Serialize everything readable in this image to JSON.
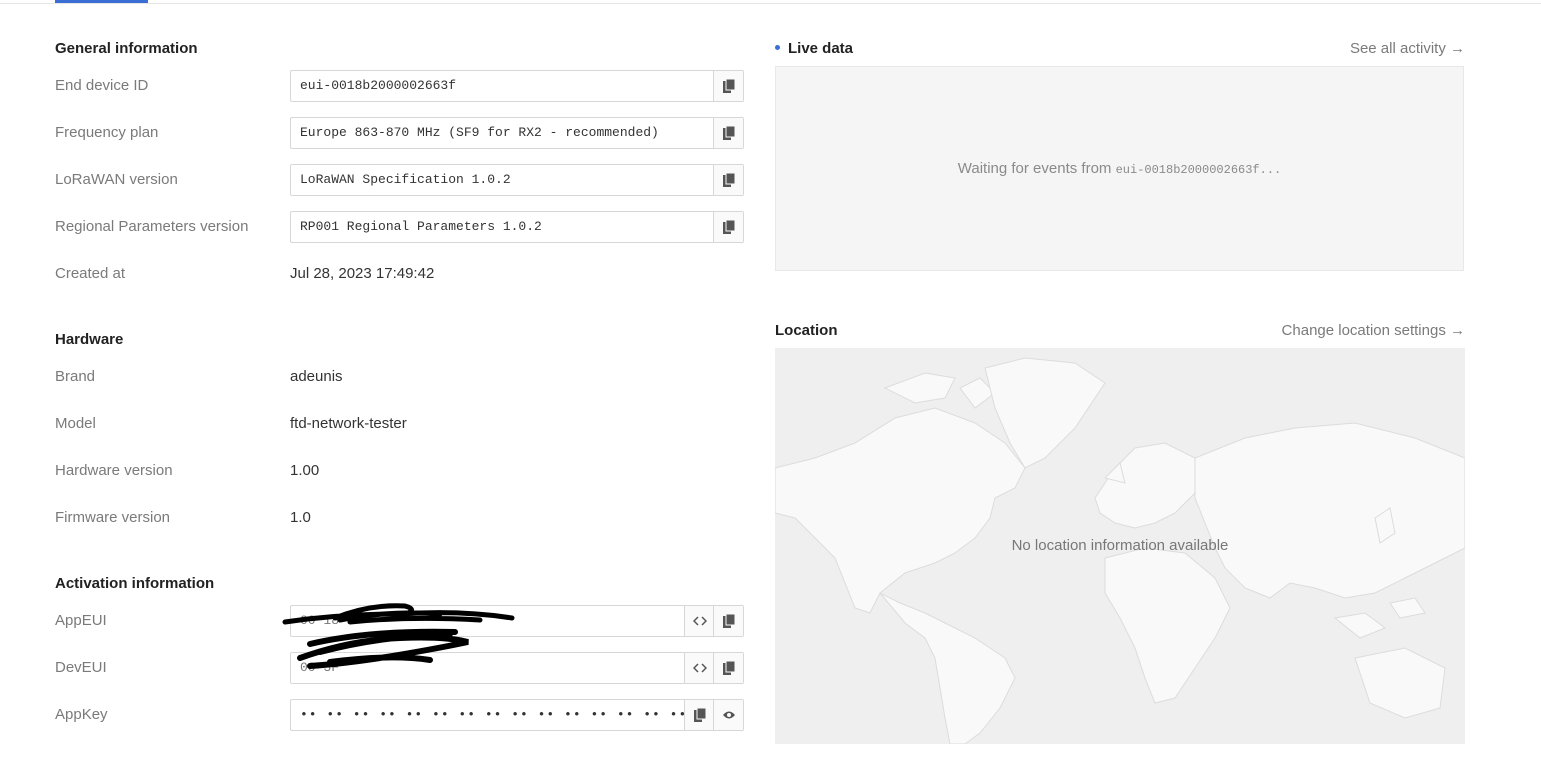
{
  "general": {
    "title": "General information",
    "rows": [
      {
        "label": "End device ID",
        "value": "eui-0018b2000002663f"
      },
      {
        "label": "Frequency plan",
        "value": "Europe 863-870 MHz (SF9 for RX2 - recommended)"
      },
      {
        "label": "LoRaWAN version",
        "value": "LoRaWAN Specification 1.0.2"
      },
      {
        "label": "Regional Parameters version",
        "value": "RP001 Regional Parameters 1.0.2"
      },
      {
        "label": "Created at",
        "value": "Jul 28, 2023 17:49:42"
      }
    ]
  },
  "hardware": {
    "title": "Hardware",
    "rows": [
      {
        "label": "Brand",
        "value": "adeunis"
      },
      {
        "label": "Model",
        "value": "ftd-network-tester"
      },
      {
        "label": "Hardware version",
        "value": "1.00"
      },
      {
        "label": "Firmware version",
        "value": "1.0"
      }
    ]
  },
  "activation": {
    "title": "Activation information",
    "rows": [
      {
        "label": "AppEUI",
        "value": "00 18"
      },
      {
        "label": "DevEUI",
        "value": "00                         3F"
      },
      {
        "label": "AppKey",
        "value": "•• •• •• •• •• •• •• •• •• •• •• •• •• •• •• ••"
      }
    ]
  },
  "live": {
    "title": "Live data",
    "link": "See all activity →",
    "waiting_prefix": "Waiting for events from ",
    "device_id": "eui-0018b2000002663f",
    "waiting_suffix": "..."
  },
  "location": {
    "title": "Location",
    "link": "Change location settings →",
    "empty": "No location information available"
  },
  "icons": {
    "copy": "copy-icon",
    "code": "code-toggle-icon",
    "eye": "eye-icon"
  },
  "colors": {
    "accent": "#3b6fd6",
    "muted_text": "#7a7a7a",
    "panel_bg": "#f5f5f5"
  }
}
